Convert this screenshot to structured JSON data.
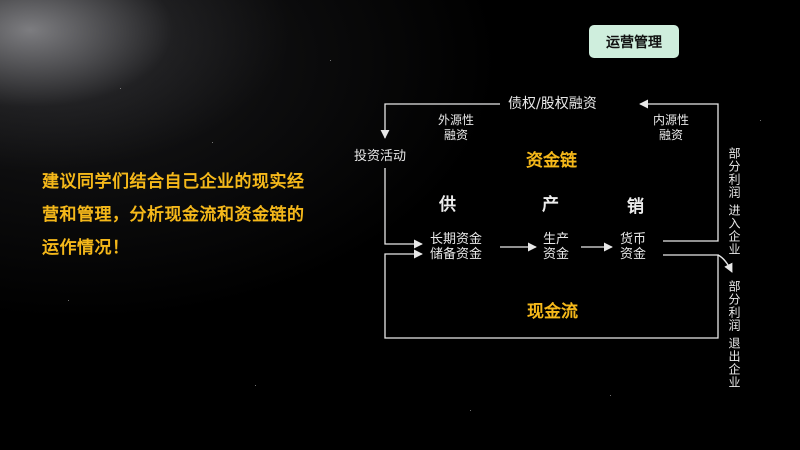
{
  "badge": "运营管理",
  "intro": "建议同学们结合自己企业的现实经营和管理，分析现金流和资金链的运作情况！",
  "diagram": {
    "financing": "债权/股权融资",
    "external_source_line1": "外源性",
    "external_source_line2": "融资",
    "internal_source_line1": "内源性",
    "internal_source_line2": "融资",
    "investment": "投资活动",
    "capital_chain": "资金链",
    "cash_flow": "现金流",
    "supply": "供",
    "produce": "产",
    "sell": "销",
    "long_term_line1": "长期资金",
    "long_term_line2": "储备资金",
    "production_line1": "生产",
    "production_line2": "资金",
    "currency_line1": "货币",
    "currency_line2": "资金",
    "retained_col1": "部分利润",
    "retained_col2": "进入企业",
    "withdrawn_col1": "部分利润",
    "withdrawn_col2": "退出企业"
  }
}
